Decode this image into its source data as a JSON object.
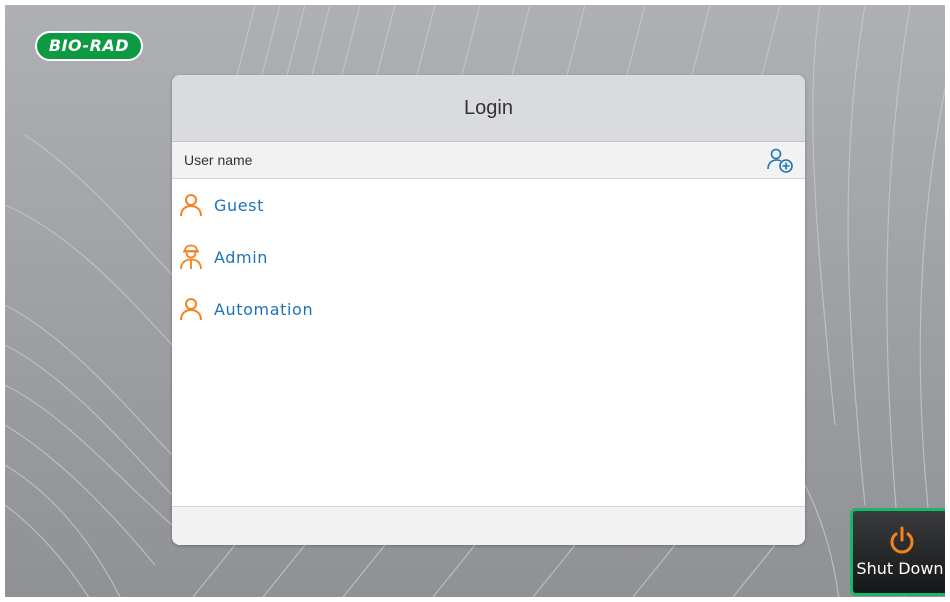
{
  "brand": {
    "logo_text": "BIO-RAD",
    "color": "#0e9a43"
  },
  "dialog": {
    "title": "Login",
    "column_header": "User name",
    "add_user_icon": "add-user-icon"
  },
  "users": [
    {
      "name": "Guest",
      "icon": "user-icon"
    },
    {
      "name": "Admin",
      "icon": "admin-user-icon"
    },
    {
      "name": "Automation",
      "icon": "user-icon"
    }
  ],
  "shutdown": {
    "label": "Shut Down",
    "icon": "power-icon",
    "accent": "#19b66a",
    "icon_color": "#f5821f"
  },
  "colors": {
    "user_icon": "#f5821f",
    "link": "#1f72b8"
  }
}
